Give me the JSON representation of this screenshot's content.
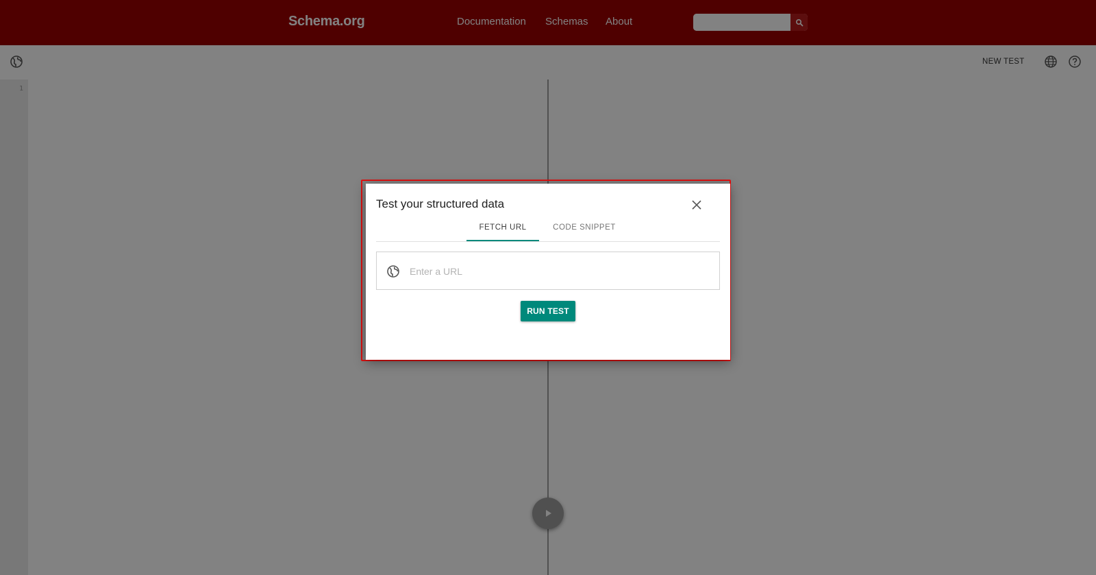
{
  "site_header": {
    "logo": "Schema.org",
    "nav": [
      "Documentation",
      "Schemas",
      "About"
    ],
    "search_placeholder": "",
    "search_icon": "search-icon",
    "background_color": "#9b0000"
  },
  "toolbar": {
    "left_icon": "globe-icon",
    "new_test_label": "NEW TEST",
    "language_icon": "language-icon",
    "help_icon": "help-icon"
  },
  "editor": {
    "line_numbers": [
      "1"
    ],
    "run_icon": "play-icon"
  },
  "dialog": {
    "title": "Test your structured data",
    "close_icon": "close-icon",
    "tabs": [
      {
        "label": "FETCH URL",
        "active": true
      },
      {
        "label": "CODE SNIPPET",
        "active": false
      }
    ],
    "url_field": {
      "icon": "globe-icon",
      "placeholder": "Enter a URL",
      "value": ""
    },
    "run_button_label": "RUN TEST",
    "accent_color": "#00897b",
    "highlight_color": "#e01010"
  }
}
